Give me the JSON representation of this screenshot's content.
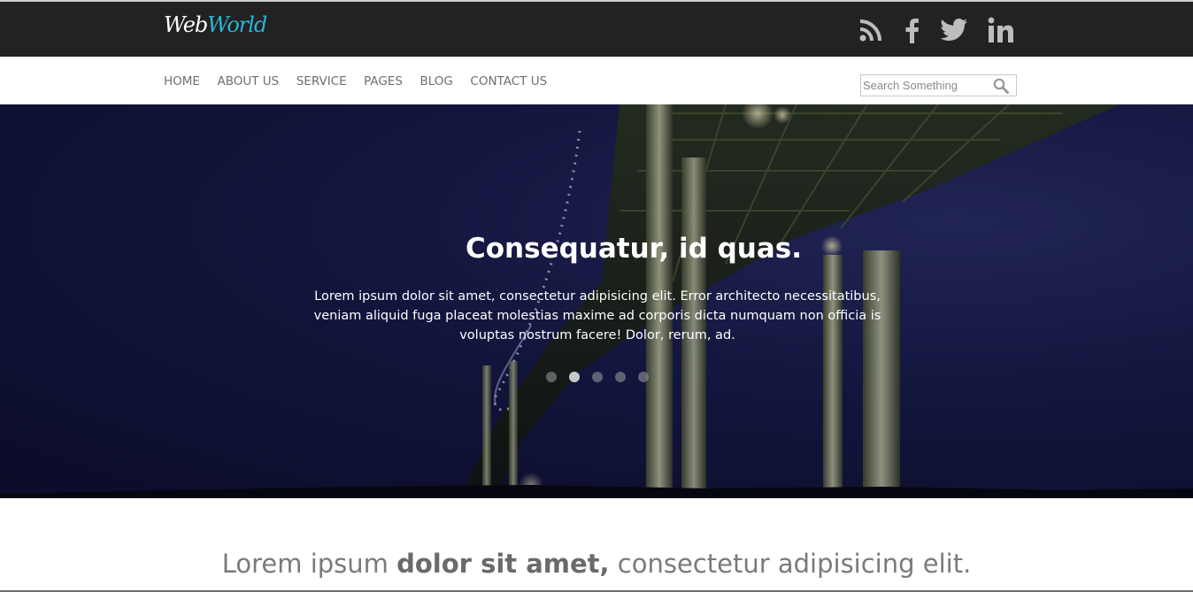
{
  "brand": {
    "logo_part1": "Web",
    "logo_part2": "World",
    "accent": "#29b6d6"
  },
  "social": [
    {
      "icon": "rss-icon"
    },
    {
      "icon": "facebook-icon"
    },
    {
      "icon": "twitter-icon"
    },
    {
      "icon": "linkedin-icon"
    }
  ],
  "nav": {
    "items": [
      "HOME",
      "ABOUT US",
      "SERVICE",
      "PAGES",
      "BLOG",
      "CONTACT US"
    ]
  },
  "search": {
    "placeholder": "Search Something",
    "icon": "search-icon"
  },
  "hero": {
    "title": "Consequatur, id quas.",
    "text": "Lorem ipsum dolor sit amet, consectetur adipisicing elit. Error architecto necessitatibus, veniam aliquid fuga placeat molestias maxime ad corporis dicta numquam non officia is voluptas nostrum facere! Dolor, rerum, ad.",
    "slides": 5,
    "active_slide": 2
  },
  "tagline": {
    "part1": "Lorem ipsum ",
    "part2": "dolor sit amet,",
    "part3": " consectetur adipisicing elit."
  },
  "colors": {
    "topbar": "#242121",
    "nav_text": "#6f6f6f",
    "icons": "#bdbdbd"
  }
}
